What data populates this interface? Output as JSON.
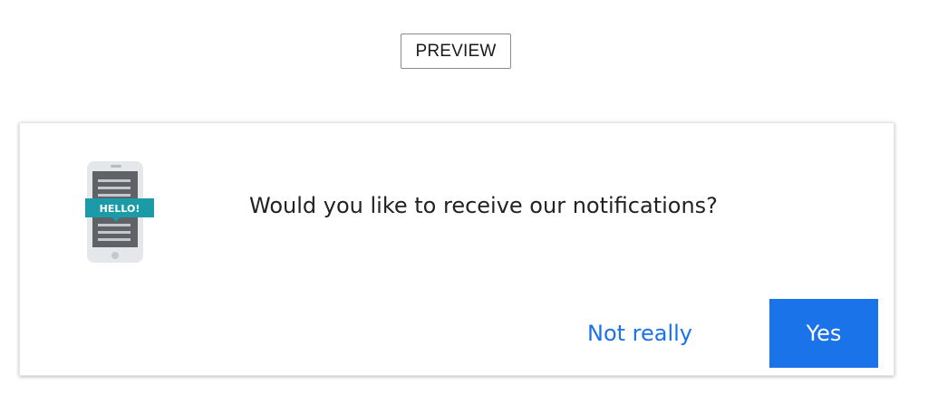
{
  "preview": {
    "label": "PREVIEW"
  },
  "prompt": {
    "message": "Would you like to receive our notifications?",
    "icon": "phone-notification-icon",
    "icon_text": "HELLO!",
    "buttons": {
      "decline_label": "Not really",
      "accept_label": "Yes"
    }
  },
  "colors": {
    "accent": "#1a73e8",
    "phone_body": "#e5e8ea",
    "phone_screen": "#5f6368",
    "banner": "#1a9ba7"
  }
}
